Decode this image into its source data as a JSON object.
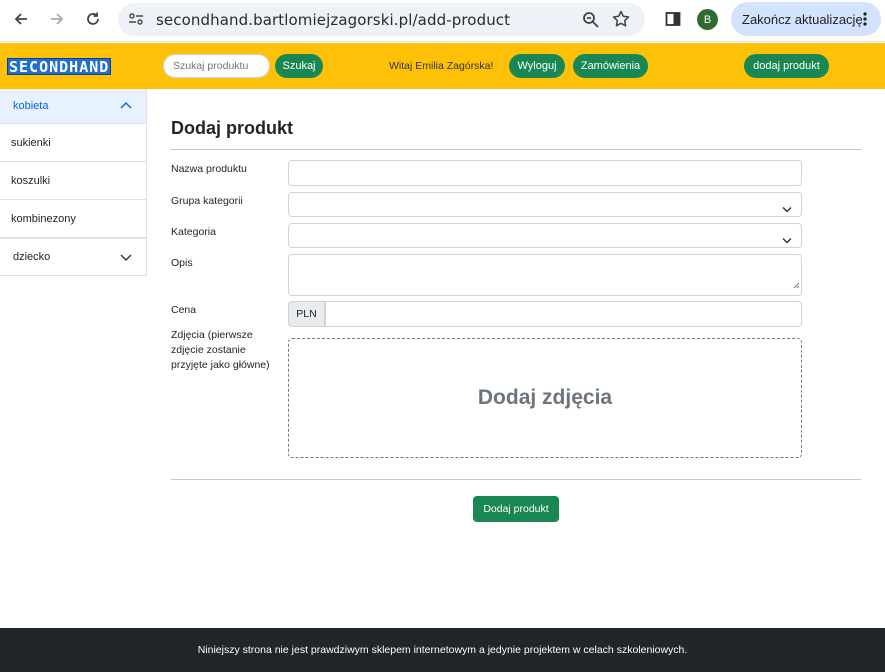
{
  "browser": {
    "url": "secondhand.bartlomiejzagorski.pl/add-product",
    "profile_initial": "B",
    "update_label": "Zakończ aktualizację"
  },
  "header": {
    "logo": "SECONDHAND",
    "search_placeholder": "Szukaj produktu",
    "search_button": "Szukaj",
    "welcome": "Witaj Emilia Zagórska!",
    "logout": "Wyloguj",
    "orders": "Zamówienia",
    "add_product": "dodaj produkt"
  },
  "sidebar": {
    "sections": [
      {
        "label": "kobieta",
        "expanded": true,
        "items": [
          "sukienki",
          "koszulki",
          "kombinezony"
        ]
      },
      {
        "label": "dziecko",
        "expanded": false,
        "items": []
      }
    ]
  },
  "form": {
    "title": "Dodaj produkt",
    "fields": {
      "name_label": "Nazwa produktu",
      "group_label": "Grupa kategorii",
      "category_label": "Kategoria",
      "description_label": "Opis",
      "price_label": "Cena",
      "currency": "PLN",
      "photos_label": "Zdjęcia (pierwsze zdjęcie zostanie przyjęte jako główne)",
      "photos_dropzone": "Dodaj zdjęcia"
    },
    "submit": "Dodaj produkt"
  },
  "footer": {
    "text": "Niniejszy strona nie jest prawdziwym sklepem internetowym a jedynie projektem w celach szkoleniowych."
  },
  "colors": {
    "header_bg": "#ffc107",
    "button_green": "#198754",
    "footer_bg": "#222529",
    "logo_bg": "#1f6fd1"
  }
}
